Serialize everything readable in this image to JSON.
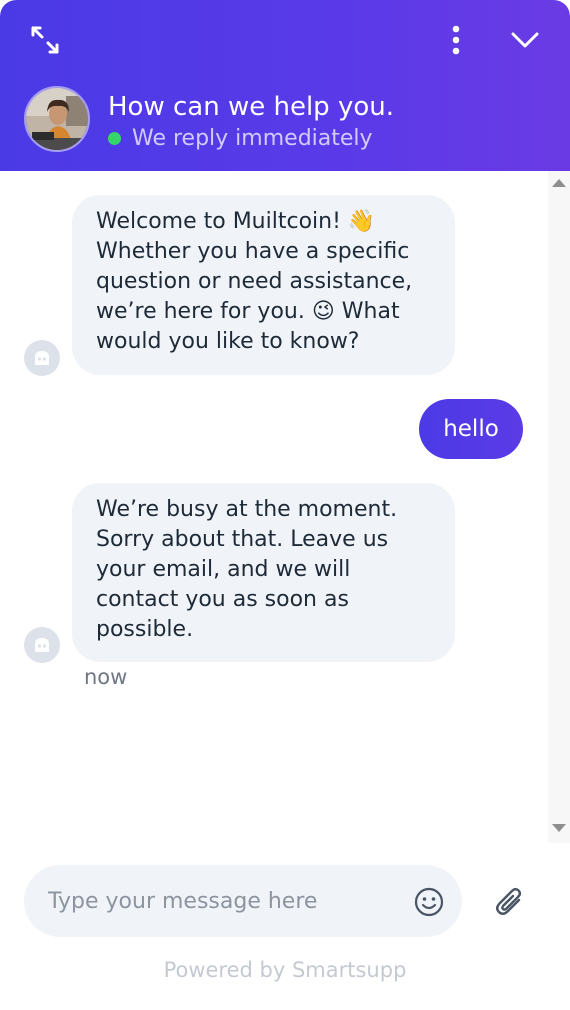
{
  "header": {
    "title": "How can we help you.",
    "status": "We reply immediately",
    "status_color": "#34d66a",
    "accent_color": "#4f3ae6",
    "icons": [
      "expand-icon",
      "more-vertical-icon",
      "chevron-down-icon"
    ]
  },
  "messages": [
    {
      "from": "bot",
      "text": "Welcome to Muiltcoin! 👋 Whether you have a specific question or need assistance, we’re here for you. 😉 What would you like to know?"
    },
    {
      "from": "visitor",
      "text": "hello"
    },
    {
      "from": "bot",
      "text": "We’re busy at the moment. Sorry about that. Leave us your email, and we will contact you as soon as possible."
    }
  ],
  "last_message_time": "now",
  "composer": {
    "placeholder": "Type your message here",
    "icons": [
      "smile-icon",
      "paperclip-icon"
    ]
  },
  "footer": {
    "powered_by": "Powered by Smartsupp"
  }
}
